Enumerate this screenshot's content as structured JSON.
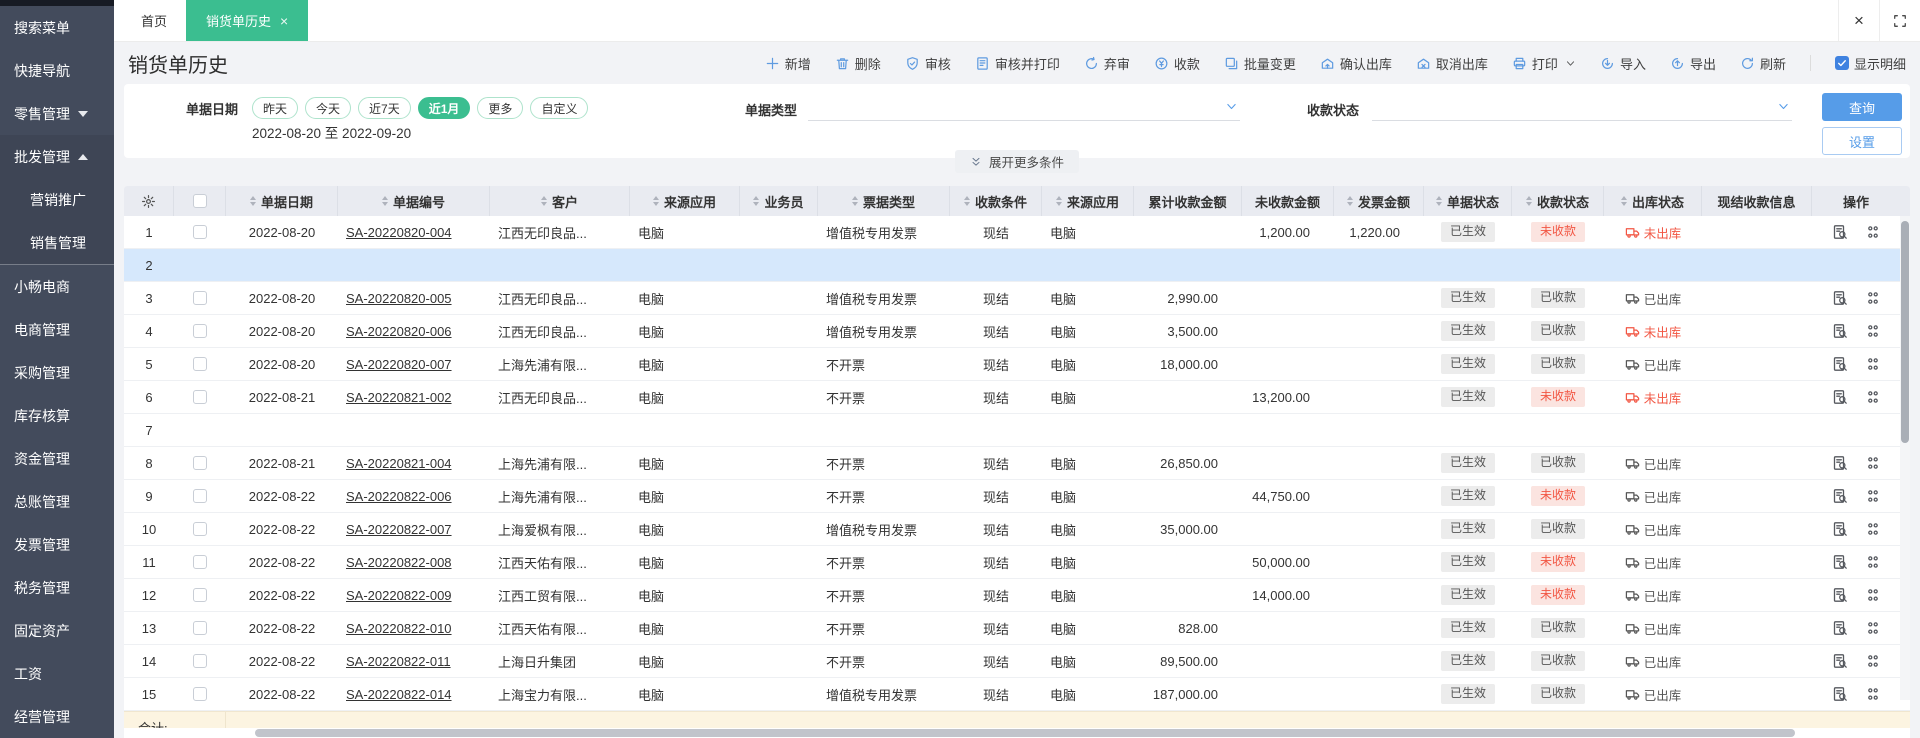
{
  "tabs": {
    "home_label": "首页",
    "active_label": "销货单历史"
  },
  "page": {
    "title": "销货单历史"
  },
  "toolbar": {
    "buttons": [
      {
        "icon": "plus",
        "label": "新增"
      },
      {
        "icon": "trash",
        "label": "删除"
      },
      {
        "icon": "audit",
        "label": "审核"
      },
      {
        "icon": "audit_print",
        "label": "审核并打印"
      },
      {
        "icon": "abandon",
        "label": "弃审"
      },
      {
        "icon": "collect",
        "label": "收款"
      },
      {
        "icon": "batch",
        "label": "批量变更"
      },
      {
        "icon": "confirm_out",
        "label": "确认出库"
      },
      {
        "icon": "cancel_out",
        "label": "取消出库"
      },
      {
        "icon": "print",
        "label": "打印",
        "caret": true
      },
      {
        "icon": "import",
        "label": "导入"
      },
      {
        "icon": "export",
        "label": "导出"
      },
      {
        "icon": "refresh",
        "label": "刷新"
      }
    ],
    "show_detail": {
      "label": "显示明细",
      "checked": true
    }
  },
  "filters": {
    "date": {
      "label": "单据日期",
      "pills": [
        {
          "label": "昨天",
          "selected": false
        },
        {
          "label": "今天",
          "selected": false
        },
        {
          "label": "近7天",
          "selected": false
        },
        {
          "label": "近1月",
          "selected": true
        },
        {
          "label": "更多",
          "selected": false
        },
        {
          "label": "自定义",
          "selected": false
        }
      ],
      "range": "2022-08-20 至 2022-09-20"
    },
    "doc_type": {
      "label": "单据类型",
      "value": ""
    },
    "pay_status": {
      "label": "收款状态",
      "value": ""
    },
    "search_label": "查询",
    "settings_label": "设置",
    "expand_label": "展开更多条件"
  },
  "table": {
    "columns": [
      {
        "type": "gear",
        "icon": "gear-icon"
      },
      {
        "type": "checkbox"
      },
      {
        "label": "单据日期",
        "sortable": true
      },
      {
        "label": "单据编号",
        "sortable": true
      },
      {
        "label": "客户",
        "sortable": true
      },
      {
        "label": "来源应用",
        "sortable": true
      },
      {
        "label": "业务员",
        "sortable": true
      },
      {
        "label": "票据类型",
        "sortable": true
      },
      {
        "label": "收款条件",
        "sortable": true
      },
      {
        "label": "来源应用",
        "sortable": true
      },
      {
        "label": "累计收款金额",
        "sortable": false
      },
      {
        "label": "未收款金额",
        "sortable": false
      },
      {
        "label": "发票金额",
        "sortable": true
      },
      {
        "label": "单据状态",
        "sortable": true
      },
      {
        "label": "收款状态",
        "sortable": true
      },
      {
        "label": "出库状态",
        "sortable": true
      },
      {
        "label": "现结收款信息",
        "sortable": false
      },
      {
        "label": "操作",
        "sortable": false
      }
    ],
    "rows": [
      {
        "idx": 1,
        "date": "2022-08-20",
        "no": "SA-20220820-004",
        "customer": "江西无印良品...",
        "source": "电脑",
        "salesman": "",
        "bill": "增值税专用发票",
        "term": "现结",
        "source2": "电脑",
        "received": "",
        "unreceived": "1,200.00",
        "invoice": "1,220.00",
        "doc_status": "已生效",
        "pay_status": "未收款",
        "pay_danger": true,
        "out_status": "未出库",
        "out_danger": true
      },
      {
        "idx": 2,
        "empty": true,
        "selected": true
      },
      {
        "idx": 3,
        "date": "2022-08-20",
        "no": "SA-20220820-005",
        "customer": "江西无印良品...",
        "source": "电脑",
        "salesman": "",
        "bill": "增值税专用发票",
        "term": "现结",
        "source2": "电脑",
        "received": "2,990.00",
        "unreceived": "",
        "invoice": "",
        "doc_status": "已生效",
        "pay_status": "已收款",
        "pay_danger": false,
        "out_status": "已出库",
        "out_danger": false
      },
      {
        "idx": 4,
        "date": "2022-08-20",
        "no": "SA-20220820-006",
        "customer": "江西无印良品...",
        "source": "电脑",
        "salesman": "",
        "bill": "增值税专用发票",
        "term": "现结",
        "source2": "电脑",
        "received": "3,500.00",
        "unreceived": "",
        "invoice": "",
        "doc_status": "已生效",
        "pay_status": "已收款",
        "pay_danger": false,
        "out_status": "未出库",
        "out_danger": true
      },
      {
        "idx": 5,
        "date": "2022-08-20",
        "no": "SA-20220820-007",
        "customer": "上海先浦有限...",
        "source": "电脑",
        "salesman": "",
        "bill": "不开票",
        "term": "现结",
        "source2": "电脑",
        "received": "18,000.00",
        "unreceived": "",
        "invoice": "",
        "doc_status": "已生效",
        "pay_status": "已收款",
        "pay_danger": false,
        "out_status": "已出库",
        "out_danger": false
      },
      {
        "idx": 6,
        "date": "2022-08-21",
        "no": "SA-20220821-002",
        "customer": "江西无印良品...",
        "source": "电脑",
        "salesman": "",
        "bill": "不开票",
        "term": "现结",
        "source2": "电脑",
        "received": "",
        "unreceived": "13,200.00",
        "invoice": "",
        "doc_status": "已生效",
        "pay_status": "未收款",
        "pay_danger": true,
        "out_status": "未出库",
        "out_danger": true
      },
      {
        "idx": 7,
        "empty": true,
        "selected": false
      },
      {
        "idx": 8,
        "date": "2022-08-21",
        "no": "SA-20220821-004",
        "customer": "上海先浦有限...",
        "source": "电脑",
        "salesman": "",
        "bill": "不开票",
        "term": "现结",
        "source2": "电脑",
        "received": "26,850.00",
        "unreceived": "",
        "invoice": "",
        "doc_status": "已生效",
        "pay_status": "已收款",
        "pay_danger": false,
        "out_status": "已出库",
        "out_danger": false
      },
      {
        "idx": 9,
        "date": "2022-08-22",
        "no": "SA-20220822-006",
        "customer": "上海先浦有限...",
        "source": "电脑",
        "salesman": "",
        "bill": "不开票",
        "term": "现结",
        "source2": "电脑",
        "received": "",
        "unreceived": "44,750.00",
        "invoice": "",
        "doc_status": "已生效",
        "pay_status": "未收款",
        "pay_danger": true,
        "out_status": "已出库",
        "out_danger": false
      },
      {
        "idx": 10,
        "date": "2022-08-22",
        "no": "SA-20220822-007",
        "customer": "上海爱枫有限...",
        "source": "电脑",
        "salesman": "",
        "bill": "增值税专用发票",
        "term": "现结",
        "source2": "电脑",
        "received": "35,000.00",
        "unreceived": "",
        "invoice": "",
        "doc_status": "已生效",
        "pay_status": "已收款",
        "pay_danger": false,
        "out_status": "已出库",
        "out_danger": false
      },
      {
        "idx": 11,
        "date": "2022-08-22",
        "no": "SA-20220822-008",
        "customer": "江西天佑有限...",
        "source": "电脑",
        "salesman": "",
        "bill": "不开票",
        "term": "现结",
        "source2": "电脑",
        "received": "",
        "unreceived": "50,000.00",
        "invoice": "",
        "doc_status": "已生效",
        "pay_status": "未收款",
        "pay_danger": true,
        "out_status": "已出库",
        "out_danger": false
      },
      {
        "idx": 12,
        "date": "2022-08-22",
        "no": "SA-20220822-009",
        "customer": "江西工贸有限...",
        "source": "电脑",
        "salesman": "",
        "bill": "不开票",
        "term": "现结",
        "source2": "电脑",
        "received": "",
        "unreceived": "14,000.00",
        "invoice": "",
        "doc_status": "已生效",
        "pay_status": "未收款",
        "pay_danger": true,
        "out_status": "已出库",
        "out_danger": false
      },
      {
        "idx": 13,
        "date": "2022-08-22",
        "no": "SA-20220822-010",
        "customer": "江西天佑有限...",
        "source": "电脑",
        "salesman": "",
        "bill": "不开票",
        "term": "现结",
        "source2": "电脑",
        "received": "828.00",
        "unreceived": "",
        "invoice": "",
        "doc_status": "已生效",
        "pay_status": "已收款",
        "pay_danger": false,
        "out_status": "已出库",
        "out_danger": false
      },
      {
        "idx": 14,
        "date": "2022-08-22",
        "no": "SA-20220822-011",
        "customer": "上海日升集团",
        "source": "电脑",
        "salesman": "",
        "bill": "不开票",
        "term": "现结",
        "source2": "电脑",
        "received": "89,500.00",
        "unreceived": "",
        "invoice": "",
        "doc_status": "已生效",
        "pay_status": "已收款",
        "pay_danger": false,
        "out_status": "已出库",
        "out_danger": false
      },
      {
        "idx": 15,
        "date": "2022-08-22",
        "no": "SA-20220822-014",
        "customer": "上海宝力有限...",
        "source": "电脑",
        "salesman": "",
        "bill": "增值税专用发票",
        "term": "现结",
        "source2": "电脑",
        "received": "187,000.00",
        "unreceived": "",
        "invoice": "",
        "doc_status": "已生效",
        "pay_status": "已收款",
        "pay_danger": false,
        "out_status": "已出库",
        "out_danger": false
      }
    ],
    "footer_label": "合计:"
  },
  "sidebar": {
    "items": [
      {
        "label": "搜索菜单",
        "type": "item"
      },
      {
        "label": "快捷导航",
        "type": "item"
      },
      {
        "label": "零售管理",
        "type": "item",
        "arrow": "down"
      },
      {
        "label": "批发管理",
        "type": "group",
        "arrow": "up"
      },
      {
        "label": "营销推广",
        "type": "sub"
      },
      {
        "label": "销售管理",
        "type": "sub"
      },
      {
        "type": "divider"
      },
      {
        "label": "小畅电商",
        "type": "item"
      },
      {
        "label": "电商管理",
        "type": "item"
      },
      {
        "label": "采购管理",
        "type": "item"
      },
      {
        "label": "库存核算",
        "type": "item"
      },
      {
        "label": "资金管理",
        "type": "item"
      },
      {
        "label": "总账管理",
        "type": "item"
      },
      {
        "label": "发票管理",
        "type": "item"
      },
      {
        "label": "税务管理",
        "type": "item"
      },
      {
        "label": "固定资产",
        "type": "item"
      },
      {
        "label": "工资",
        "type": "item"
      },
      {
        "label": "经营管理",
        "type": "item"
      }
    ]
  },
  "colors": {
    "accent_green": "#3bbe90",
    "accent_blue": "#569ce8",
    "danger": "#f25643",
    "selected_row": "#d6e8fc"
  }
}
